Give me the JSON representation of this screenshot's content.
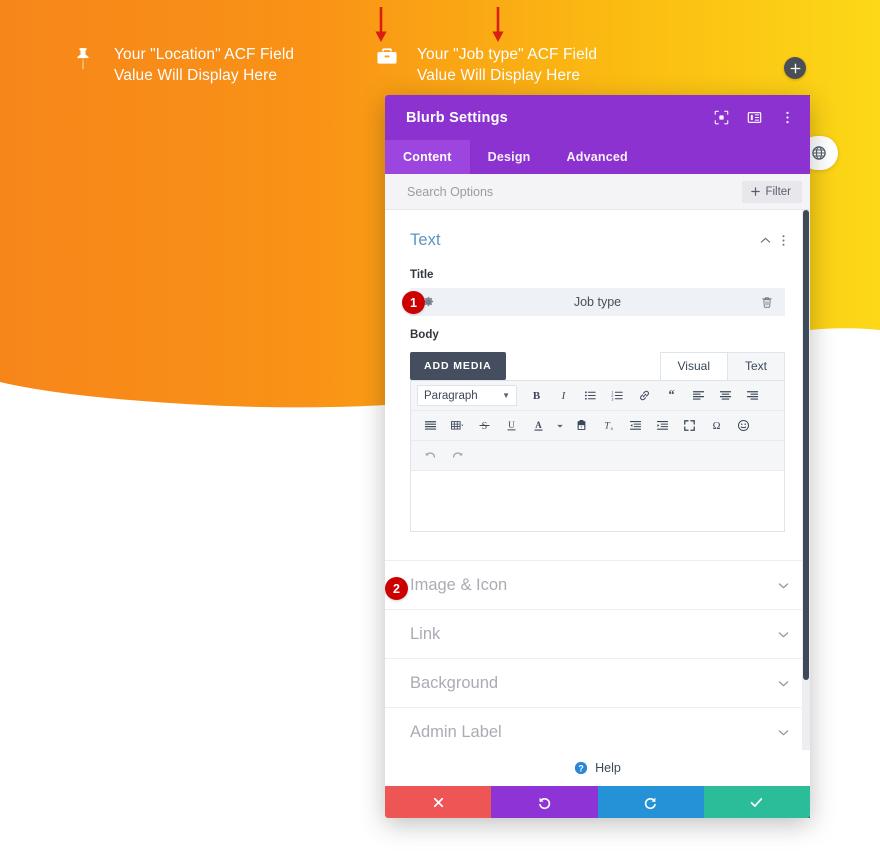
{
  "page": {
    "background": {
      "gradient_from": "#f7931e",
      "gradient_to": "#fbd01a",
      "wave_fill": "#f79a1c"
    }
  },
  "hero": {
    "fields": [
      {
        "icon": "map-pin-icon",
        "text": "Your \"Location\" ACF Field\nValue Will Display Here"
      },
      {
        "icon": "briefcase-icon",
        "text": "Your \"Job type\" ACF Field\nValue Will Display Here"
      }
    ],
    "arrows": [
      "down-arrow-icon",
      "down-arrow-icon"
    ],
    "arrow_color": "#d91f12",
    "add_button": {
      "icon": "plus-icon",
      "label": "+"
    },
    "globe_chip": {
      "icon": "globe-icon"
    }
  },
  "modal": {
    "title": "Blurb Settings",
    "accent": "#8b32d0",
    "header_icons": [
      {
        "name": "focus-expand-icon"
      },
      {
        "name": "layout-split-icon"
      },
      {
        "name": "more-vertical-icon"
      }
    ],
    "tabs": [
      {
        "label": "Content",
        "active": true
      },
      {
        "label": "Design",
        "active": false
      },
      {
        "label": "Advanced",
        "active": false
      }
    ],
    "search": {
      "placeholder": "Search Options",
      "value": ""
    },
    "filter_button": {
      "label": "Filter",
      "icon": "plus-icon"
    },
    "sections": {
      "text": {
        "heading": "Text",
        "badge": "1",
        "title_label": "Title",
        "title_value": "Job type",
        "title_row_icons": {
          "settings": "gear-icon",
          "delete": "trash-icon"
        },
        "body_label": "Body",
        "add_media_label": "ADD MEDIA",
        "editor_tabs": [
          {
            "label": "Visual",
            "active": true
          },
          {
            "label": "Text",
            "active": false
          }
        ],
        "format_select": "Paragraph",
        "toolbar_row1": [
          "bold-icon",
          "italic-icon",
          "bulleted-list-icon",
          "numbered-list-icon",
          "link-icon",
          "blockquote-icon",
          "align-left-icon",
          "align-center-icon",
          "align-right-icon"
        ],
        "toolbar_row2": [
          "align-justify-icon",
          "table-icon",
          "strikethrough-icon",
          "underline-icon",
          "text-color-icon",
          "paste-as-text-icon",
          "clear-formatting-icon",
          "outdent-icon",
          "indent-icon",
          "fullscreen-icon",
          "special-character-icon",
          "emoji-icon"
        ],
        "toolbar_row3": [
          "undo-icon",
          "redo-icon"
        ],
        "body_value": ""
      },
      "collapsed": [
        {
          "label": "Image & Icon",
          "badge": "2",
          "chevron": "chevron-down-icon"
        },
        {
          "label": "Link",
          "badge": "",
          "chevron": "chevron-down-icon"
        },
        {
          "label": "Background",
          "badge": "",
          "chevron": "chevron-down-icon"
        },
        {
          "label": "Admin Label",
          "badge": "",
          "chevron": "chevron-down-icon"
        }
      ]
    },
    "help": {
      "label": "Help",
      "icon": "question-mark-icon"
    },
    "footer_buttons": [
      {
        "name": "cancel",
        "icon": "close-x-icon",
        "color": "#ee5555"
      },
      {
        "name": "undo",
        "icon": "undo-arrow-icon",
        "color": "#8e34d6"
      },
      {
        "name": "redo",
        "icon": "redo-arrow-icon",
        "color": "#2591d6"
      },
      {
        "name": "save",
        "icon": "checkmark-icon",
        "color": "#2bbd9a"
      }
    ]
  }
}
